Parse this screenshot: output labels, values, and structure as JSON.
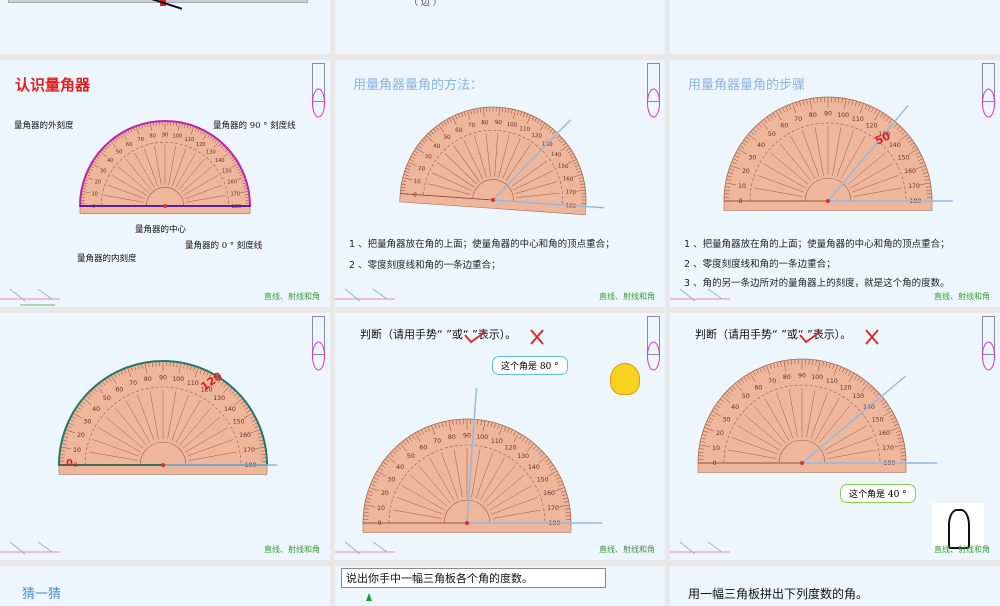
{
  "slides": [
    {
      "id": "top-middle",
      "text": "（ 边 ）"
    },
    {
      "id": "recognize",
      "title": "认识量角器",
      "labels": {
        "outer": "量角器的外刻度",
        "line90": "量角器的 90 ° 刻度线",
        "center": "量角器的中心",
        "inner": "量角器的内刻度",
        "zero_line": "量角器的 0 ° 刻度线"
      },
      "footer": "直线、射线和角"
    },
    {
      "id": "method",
      "title": "用量角器量角的方法：",
      "steps": [
        "1 、把量角器放在角的上面；使量角器的中心和角的顶点重合；",
        "2 、零度刻度线和角的一条边重合；"
      ],
      "footer": "直线、射线和角"
    },
    {
      "id": "steps",
      "title": "用量角器量角的步骤",
      "mark": "50",
      "steps": [
        "1 、把量角器放在角的上面；使量角器的中心和角的顶点重合；",
        "2 、零度刻度线和角的一条边重合；",
        "3 、角的另一条边所对的量角器上的刻度，就是这个角的度数。"
      ],
      "footer": "直线、射线和角"
    },
    {
      "id": "reading",
      "mark": "120",
      "zero": "0",
      "footer": "直线、射线和角"
    },
    {
      "id": "judge-80",
      "prompt": "判断（请用手势“    ”或“     ”表示）。",
      "bubble": "这个角是 80 °",
      "footer": "直线、射线和角"
    },
    {
      "id": "judge-40",
      "prompt": "判断（请用手势“    ”或“     ”表示）。",
      "bubble": "这个角是 40 °",
      "footer": "直线、射线和角"
    },
    {
      "id": "guess",
      "title": "猜一猜"
    },
    {
      "id": "triangle-ask",
      "text": "说出你手中一幅三角板各个角的度数。"
    },
    {
      "id": "triangle-make",
      "text": "用一幅三角板拼出下列度数的角。"
    }
  ],
  "colors": {
    "slide_bg": "#eef6fd",
    "protractor": "#eeb79c",
    "footer": "#3a9a3a",
    "title_blue": "#8db4df",
    "title_red": "#e02020"
  }
}
